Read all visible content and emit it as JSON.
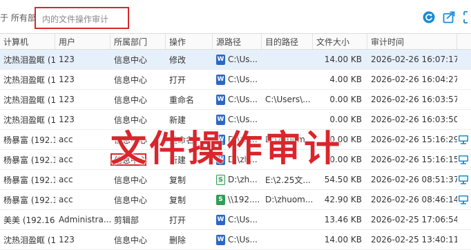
{
  "toolbar": {
    "filter_prefix": "于 所有部门",
    "search_placeholder": "内的文件操作审计",
    "icons": [
      "refresh-icon",
      "export-icon",
      "fullscreen-icon"
    ]
  },
  "table": {
    "columns": [
      "计算机",
      "用户",
      "所属部门",
      "操作",
      "源路径",
      "目的路径",
      "文件大小",
      "审计时间"
    ],
    "rows": [
      {
        "computer": "沈热泪盈眶 (1...",
        "user": "123",
        "dept": "信息中心",
        "op": "修改",
        "src_icon": "word",
        "src": "C:\\Us...",
        "dst": "",
        "size": "14.00 KB",
        "time": "2026-02-26 16:07:17",
        "screen": false,
        "selected": true
      },
      {
        "computer": "沈热泪盈眶 (1...",
        "user": "123",
        "dept": "信息中心",
        "op": "打开",
        "src_icon": "word",
        "src": "C:\\Us...",
        "dst": "",
        "size": "4.00 KB",
        "time": "2026-02-26 16:04:27",
        "screen": false,
        "selected": false
      },
      {
        "computer": "沈热泪盈眶 (1...",
        "user": "123",
        "dept": "信息中心",
        "op": "重命名",
        "src_icon": "word",
        "src": "C:\\Us...",
        "dst": "C:\\Users\\...",
        "size": "0.00 KB",
        "time": "2026-02-26 16:03:57",
        "screen": false,
        "selected": false
      },
      {
        "computer": "沈热泪盈眶 (1...",
        "user": "123",
        "dept": "信息中心",
        "op": "新建",
        "src_icon": "word",
        "src": "C:\\Us...",
        "dst": "",
        "size": "0.00 KB",
        "time": "2026-02-26 16:03:50",
        "screen": false,
        "selected": false
      },
      {
        "computer": "杨暴富 (192.1...",
        "user": "acc",
        "dept": "信息中心",
        "op": "重命名",
        "src_icon": "word",
        "src": "D:\\zh...",
        "dst": "D:\\zhuom...",
        "size": "0.00 KB",
        "time": "2026-02-26 15:16:29",
        "screen": true,
        "selected": false
      },
      {
        "computer": "杨暴富 (192.1...",
        "user": "acc",
        "dept": "信息中心",
        "op": "新建",
        "src_icon": "word",
        "src": "D:\\zh...",
        "dst": "",
        "size": "0.00 KB",
        "time": "2026-02-26 15:16:15",
        "screen": true,
        "selected": false
      },
      {
        "computer": "杨暴富 (192.1...",
        "user": "acc",
        "dept": "信息中心",
        "op": "复制",
        "src_icon": "wps",
        "src": "D:\\zh...",
        "dst": "E:\\2.25文...",
        "size": "54.50 KB",
        "time": "2026-02-26 08:51:37",
        "screen": true,
        "selected": false
      },
      {
        "computer": "杨暴富 (192.1...",
        "user": "acc",
        "dept": "信息中心",
        "op": "复制",
        "src_icon": "sheet",
        "src": "\\\\192....",
        "dst": "D:\\zhuom...",
        "size": "42.90 KB",
        "time": "2026-02-26 08:46:14",
        "screen": true,
        "selected": false
      },
      {
        "computer": "美美 (192.16...",
        "user": "Administra...",
        "dept": "剪辑部",
        "op": "打开",
        "src_icon": "word",
        "src": "C:\\Us...",
        "dst": "",
        "size": "13.46 KB",
        "time": "2026-02-25 17:06:54",
        "screen": false,
        "selected": false
      },
      {
        "computer": "沈热泪盈眶 (1...",
        "user": "123",
        "dept": "信息中心",
        "op": "删除",
        "src_icon": "word",
        "src": "C:\\Us...",
        "dst": "",
        "size": "14.00 KB",
        "time": "2026-02-25 13:40:11",
        "screen": false,
        "selected": false
      }
    ]
  },
  "overlay": {
    "title": "文件操作审计"
  },
  "colors": {
    "accent_red": "#d9262c",
    "icon_blue": "#1a8ad6",
    "word_blue": "#2b67c6",
    "sheet_green": "#2f9e58",
    "selected_row": "#e6f0fb"
  }
}
